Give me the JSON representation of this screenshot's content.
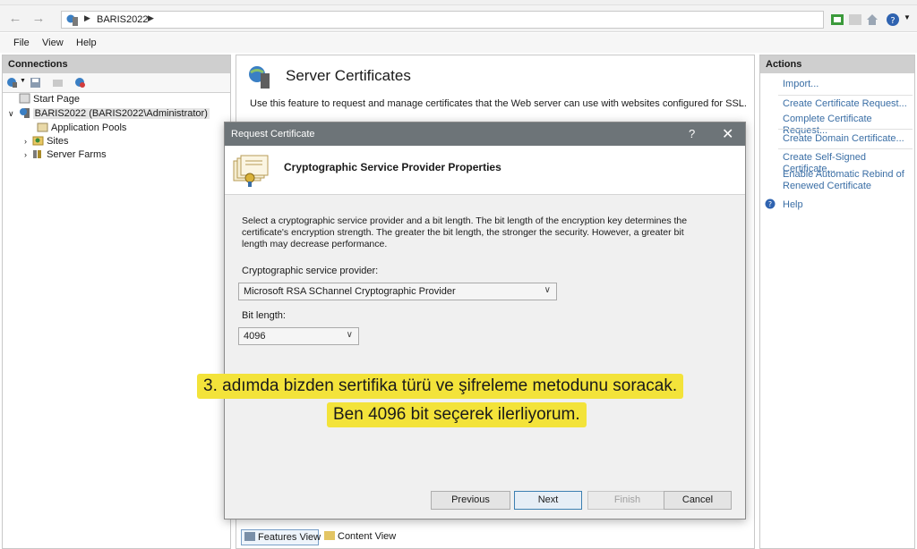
{
  "address_bar": {
    "back_icon": "arrow-left-icon",
    "forward_icon": "arrow-right-icon",
    "breadcrumb": "BARIS2022"
  },
  "menu": {
    "file": "File",
    "view": "View",
    "help": "Help"
  },
  "connections": {
    "header": "Connections",
    "tree": {
      "start_page": "Start Page",
      "server": "BARIS2022 (BARIS2022\\Administrator)",
      "app_pools": "Application Pools",
      "sites": "Sites",
      "server_farms": "Server Farms"
    }
  },
  "feature": {
    "title": "Server Certificates",
    "description": "Use this feature to request and manage certificates that the Web server can use with websites configured for SSL.",
    "features_view_tab": "Features View",
    "content_view_tab": "Content View"
  },
  "actions": {
    "header": "Actions",
    "import": "Import...",
    "create_request": "Create Certificate Request...",
    "complete_request": "Complete Certificate Request...",
    "create_domain": "Create Domain Certificate...",
    "create_self_signed": "Create Self-Signed Certificate...",
    "auto_rebind": "Enable Automatic Rebind of Renewed Certificate",
    "help": "Help"
  },
  "dialog": {
    "title": "Request Certificate",
    "help_glyph": "?",
    "close_glyph": "✕",
    "header": "Cryptographic Service Provider Properties",
    "body": "Select a cryptographic service provider and a bit length. The bit length of the encryption key determines the certificate's encryption strength. The greater the bit length, the stronger the security. However, a greater bit length may decrease performance.",
    "csp_label": "Cryptographic service provider:",
    "csp_value": "Microsoft RSA SChannel Cryptographic Provider",
    "bit_label": "Bit length:",
    "bit_value": "4096",
    "buttons": {
      "previous": "Previous",
      "next": "Next",
      "finish": "Finish",
      "cancel": "Cancel"
    }
  },
  "caption": {
    "line1": "3. adımda bizden sertifika türü ve şifreleme metodunu soracak.",
    "line2": "Ben 4096 bit seçerek ilerliyorum."
  },
  "colors": {
    "caption_bg": "#f3e33a",
    "dialog_title_bg": "#6d7478",
    "link": "#3a6ea5"
  }
}
